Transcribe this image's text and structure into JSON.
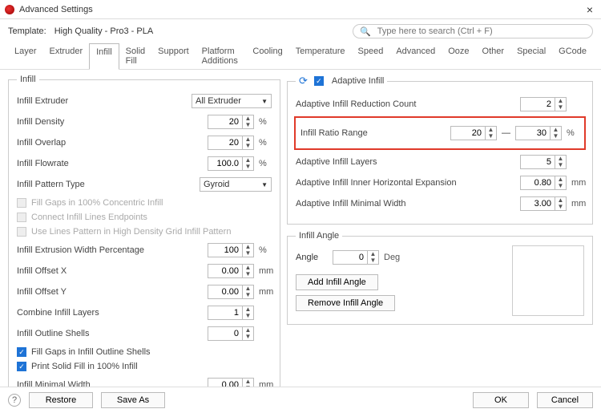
{
  "window": {
    "title": "Advanced Settings",
    "close": "×"
  },
  "template": {
    "label": "Template:",
    "value": "High Quality - Pro3 - PLA"
  },
  "search": {
    "placeholder": "Type here to search (Ctrl + F)"
  },
  "tabs": [
    "Layer",
    "Extruder",
    "Infill",
    "Solid Fill",
    "Support",
    "Platform Additions",
    "Cooling",
    "Temperature",
    "Speed",
    "Advanced",
    "Ooze",
    "Other",
    "Special",
    "GCode"
  ],
  "active_tab": "Infill",
  "left": {
    "legend": "Infill",
    "extruder_label": "Infill Extruder",
    "extruder_value": "All Extruder",
    "density_label": "Infill Density",
    "density_value": "20",
    "density_unit": "%",
    "overlap_label": "Infill Overlap",
    "overlap_value": "20",
    "overlap_unit": "%",
    "flow_label": "Infill Flowrate",
    "flow_value": "100.0",
    "flow_unit": "%",
    "pattern_label": "Infill Pattern Type",
    "pattern_value": "Gyroid",
    "cb1": "Fill Gaps in 100% Concentric Infill",
    "cb2": "Connect Infill Lines Endpoints",
    "cb3": "Use Lines Pattern in High Density Grid Infill Pattern",
    "ewp_label": "Infill Extrusion Width Percentage",
    "ewp_value": "100",
    "ewp_unit": "%",
    "offx_label": "Infill Offset X",
    "offx_value": "0.00",
    "offx_unit": "mm",
    "offy_label": "Infill Offset Y",
    "offy_value": "0.00",
    "offy_unit": "mm",
    "combine_label": "Combine Infill Layers",
    "combine_value": "1",
    "outline_label": "Infill Outline Shells",
    "outline_value": "0",
    "cb4": "Fill Gaps in Infill Outline Shells",
    "cb5": "Print Solid Fill in 100% Infill",
    "minw_label": "Infill Minimal Width",
    "minw_value": "0.00",
    "minw_unit": "mm"
  },
  "adaptive": {
    "legend": "Adaptive Infill",
    "reduction_label": "Adaptive Infill Reduction Count",
    "reduction_value": "2",
    "ratio_label": "Infill Ratio Range",
    "ratio_low": "20",
    "ratio_high": "30",
    "ratio_sep": "—",
    "ratio_unit": "%",
    "layers_label": "Adaptive Infill Layers",
    "layers_value": "5",
    "hexp_label": "Adaptive Infill Inner Horizontal Expansion",
    "hexp_value": "0.80",
    "hexp_unit": "mm",
    "minw_label": "Adaptive Infill Minimal Width",
    "minw_value": "3.00",
    "minw_unit": "mm"
  },
  "angle": {
    "legend": "Infill Angle",
    "label": "Angle",
    "value": "0",
    "unit": "Deg",
    "add": "Add Infill Angle",
    "remove": "Remove Infill Angle"
  },
  "footer": {
    "restore": "Restore",
    "saveas": "Save As",
    "ok": "OK",
    "cancel": "Cancel"
  }
}
